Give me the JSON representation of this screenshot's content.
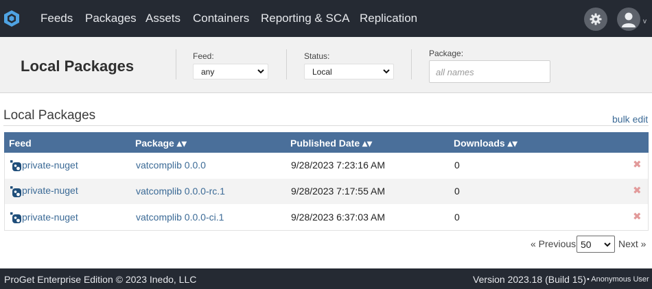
{
  "nav": {
    "logo_icon": "proget-hexagon-icon",
    "items": [
      {
        "label": "Feeds"
      },
      {
        "label": "Packages"
      },
      {
        "label": "Assets"
      },
      {
        "label": "Containers"
      },
      {
        "label": "Reporting & SCA"
      },
      {
        "label": "Replication"
      }
    ],
    "settings_icon": "gear-icon",
    "user_icon": "user-avatar-icon",
    "user_caret": "v"
  },
  "filters": {
    "page_title": "Local Packages",
    "feed": {
      "label": "Feed:",
      "value": "any"
    },
    "status": {
      "label": "Status:",
      "value": "Local"
    },
    "package": {
      "label": "Package:",
      "placeholder": "all names"
    }
  },
  "content": {
    "section_title": "Local Packages",
    "bulk_edit": "bulk edit"
  },
  "table": {
    "headers": [
      {
        "label": "Feed",
        "sort": ""
      },
      {
        "label": "Package",
        "sort": "▴▾"
      },
      {
        "label": "Published Date",
        "sort": "▴▾"
      },
      {
        "label": "Downloads",
        "sort": "▴▾"
      }
    ],
    "rows": [
      {
        "feed": "private-nuget",
        "package": "vatcomplib 0.0.0",
        "published": "9/28/2023 7:23:16 AM",
        "downloads": "0",
        "delete": "✖"
      },
      {
        "feed": "private-nuget",
        "package": "vatcomplib 0.0.0-rc.1",
        "published": "9/28/2023 7:17:55 AM",
        "downloads": "0",
        "delete": "✖"
      },
      {
        "feed": "private-nuget",
        "package": "vatcomplib 0.0.0-ci.1",
        "published": "9/28/2023 6:37:03 AM",
        "downloads": "0",
        "delete": "✖"
      }
    ]
  },
  "pager": {
    "prev": "« Previous",
    "page_size": "50",
    "next": "Next »"
  },
  "footer": {
    "edition": "ProGet Enterprise Edition © 2023 Inedo, LLC",
    "version": "Version 2023.18 (Build 15)",
    "user": "• Anonymous User"
  },
  "colors": {
    "nav_bg": "#252a33",
    "table_header_bg": "#4a6f9a",
    "link": "#3b6a96",
    "delete": "#e29a9a"
  }
}
